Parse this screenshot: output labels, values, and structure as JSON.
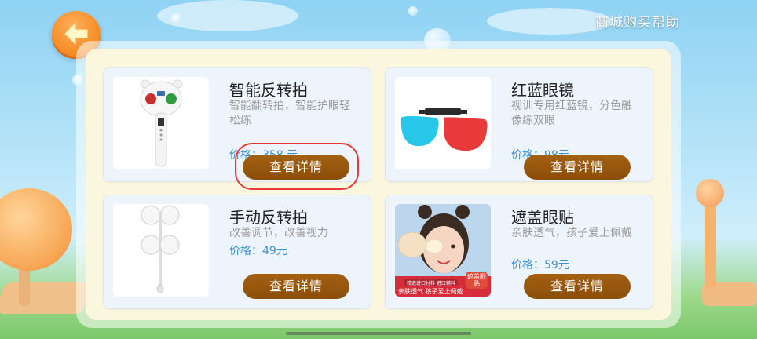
{
  "header": {
    "help_link": "商城购买帮助"
  },
  "products": [
    {
      "title": "智能反转拍",
      "desc": "智能翻转拍，智能护眼轻松练",
      "price": "价格：358 元",
      "button": "查看详情"
    },
    {
      "title": "红蓝眼镜",
      "desc": "视训专用红蓝镜，分色融像练双眼",
      "price": "价格：98元",
      "button": "查看详情"
    },
    {
      "title": "手动反转拍",
      "desc": "改善调节，改善视力",
      "price": "价格：49元",
      "button": "查看详情"
    },
    {
      "title": "遮盖眼贴",
      "desc": "亲肤透气，孩子爱上佩戴",
      "price": "价格：59元",
      "button": "查看详情"
    }
  ],
  "eye_patch_image": {
    "badge": "遮盖眼贴",
    "tagline": "精选进口材料 进口辅料",
    "banner": "亲肤透气 孩子爱上佩戴"
  },
  "colors": {
    "back_button": "#f58a21",
    "detail_button": "#8b4e08",
    "price": "#3b8fd2",
    "highlight": "#e53a35"
  }
}
